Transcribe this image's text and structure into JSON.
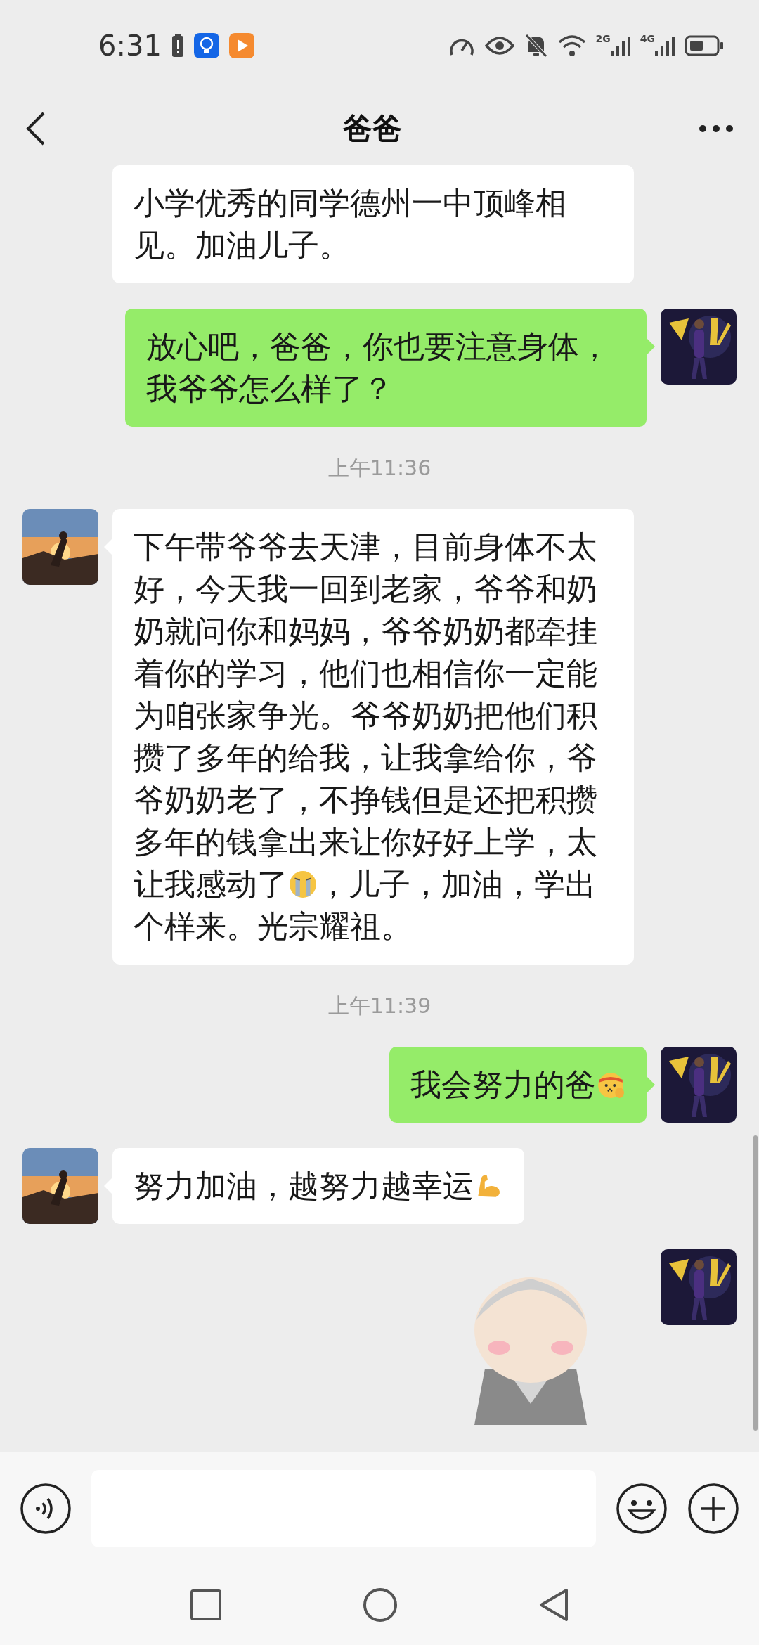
{
  "status_bar": {
    "time": "6:31",
    "network_labels": [
      "2G",
      "4G"
    ]
  },
  "header": {
    "title": "爸爸"
  },
  "messages": [
    {
      "kind": "text",
      "from_me": false,
      "avatar": false,
      "parts": [
        {
          "kind": "text",
          "text": "小学优秀的同学德州一中顶峰相见。加油儿子。"
        }
      ]
    },
    {
      "kind": "text",
      "from_me": true,
      "avatar": true,
      "parts": [
        {
          "kind": "text",
          "text": "放心吧，爸爸，你也要注意身体，我爷爷怎么样了？"
        }
      ]
    },
    {
      "kind": "time",
      "text": "上午11:36"
    },
    {
      "kind": "text",
      "from_me": false,
      "avatar": true,
      "parts": [
        {
          "kind": "text",
          "text": "下午带爷爷去天津，目前身体不太好，今天我一回到老家，爷爷和奶奶就问你和妈妈，爷爷奶奶都牵挂着你的学习，他们也相信你一定能为咱张家争光。爷爷奶奶把他们积攒了多年的给我，让我拿给你，爷爷奶奶老了，不挣钱但是还把积攒多年的钱拿出来让你好好上学，太让我感动了"
        },
        {
          "kind": "crying"
        },
        {
          "kind": "text",
          "text": "，儿子，加油，学出个样来。光宗耀祖。"
        }
      ]
    },
    {
      "kind": "time",
      "text": "上午11:39"
    },
    {
      "kind": "text",
      "from_me": true,
      "avatar": true,
      "parts": [
        {
          "kind": "text",
          "text": "我会努力的爸"
        },
        {
          "kind": "headband"
        }
      ]
    },
    {
      "kind": "text",
      "from_me": false,
      "avatar": true,
      "parts": [
        {
          "kind": "text",
          "text": "努力加油，越努力越幸运"
        },
        {
          "kind": "muscle"
        }
      ]
    },
    {
      "kind": "sticker",
      "from_me": true,
      "avatar": true
    }
  ]
}
